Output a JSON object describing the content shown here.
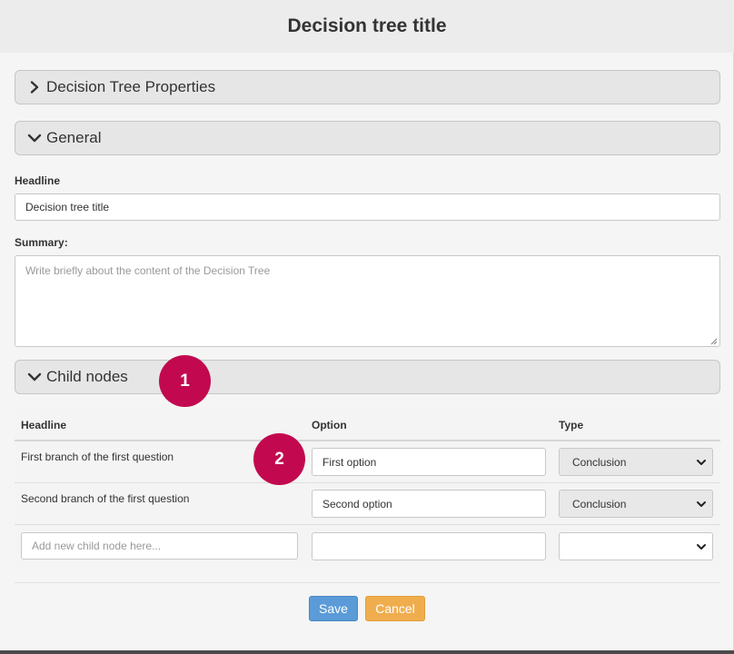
{
  "dialog": {
    "title": "Decision tree title"
  },
  "panels": {
    "properties_label": "Decision Tree Properties",
    "general_label": "General",
    "child_nodes_label": "Child nodes"
  },
  "general": {
    "headline_label": "Headline",
    "headline_value": "Decision tree title",
    "summary_label": "Summary:",
    "summary_placeholder": "Write briefly about the content of the Decision Tree"
  },
  "child_table": {
    "headers": {
      "headline": "Headline",
      "option": "Option",
      "type": "Type"
    },
    "rows": [
      {
        "headline": "First branch of the first question",
        "option": "First option",
        "type": "Conclusion"
      },
      {
        "headline": "Second branch of the first question",
        "option": "Second option",
        "type": "Conclusion"
      }
    ],
    "new_row": {
      "headline_placeholder": "Add new child node here...",
      "option": "",
      "type": ""
    }
  },
  "buttons": {
    "save": "Save",
    "cancel": "Cancel"
  },
  "callouts": {
    "one": "1",
    "two": "2"
  },
  "colors": {
    "save": "#5b9bd8",
    "cancel": "#f0ad4e",
    "callout": "#c2094f"
  },
  "icons": {
    "collapsed": "chevron-right-icon",
    "expanded": "chevron-down-icon",
    "select_caret": "caret-down-icon"
  }
}
